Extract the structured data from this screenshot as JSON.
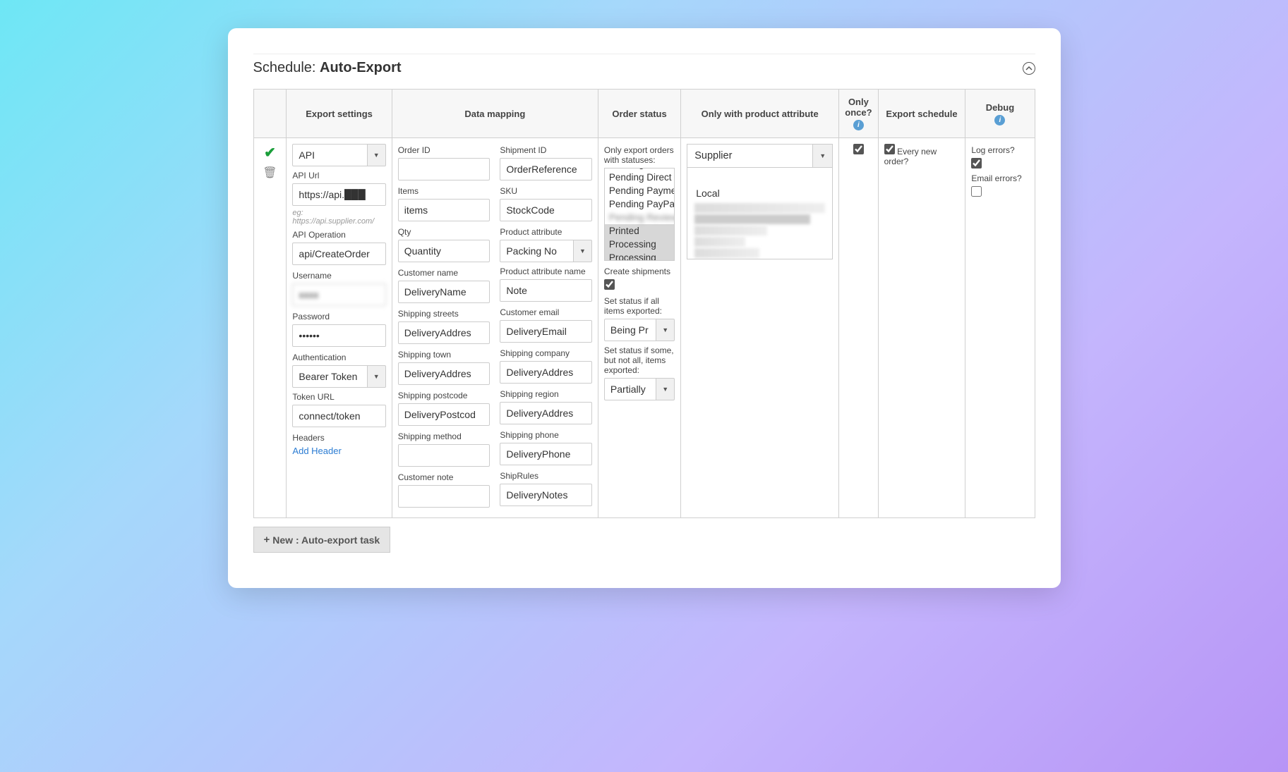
{
  "header": {
    "prefix": "Schedule: ",
    "title": "Auto-Export"
  },
  "columns": {
    "icons": "",
    "export_settings": "Export settings",
    "data_mapping": "Data mapping",
    "order_status": "Order status",
    "product_attr": "Only with product attribute",
    "only_once": "Only once?",
    "export_schedule": "Export schedule",
    "debug": "Debug"
  },
  "export_settings": {
    "method": "API",
    "api_url_label": "API Url",
    "api_url": "https://api.",
    "api_url_blur": "xxxxx",
    "api_url_hint": "eg: https://api.supplier.com/",
    "api_op_label": "API Operation",
    "api_op": "api/CreateOrder",
    "username_label": "Username",
    "username_blur": "xxxx",
    "password_label": "Password",
    "password": "••••••",
    "auth_label": "Authentication",
    "auth": "Bearer Token",
    "token_url_label": "Token URL",
    "token_url": "connect/token",
    "headers_label": "Headers",
    "add_header": "Add Header"
  },
  "mapping": {
    "left": [
      {
        "label": "Order ID",
        "value": ""
      },
      {
        "label": "Items",
        "value": "items"
      },
      {
        "label": "Qty",
        "value": "Quantity"
      },
      {
        "label": "Customer name",
        "value": "DeliveryName"
      },
      {
        "label": "Shipping streets",
        "value": "DeliveryAddres"
      },
      {
        "label": "Shipping town",
        "value": "DeliveryAddres"
      },
      {
        "label": "Shipping postcode",
        "value": "DeliveryPostcod"
      },
      {
        "label": "Shipping method",
        "value": ""
      },
      {
        "label": "Customer note",
        "value": ""
      }
    ],
    "right": [
      {
        "label": "Shipment ID",
        "value": "OrderReference"
      },
      {
        "label": "SKU",
        "value": "StockCode"
      },
      {
        "label": "Product attribute",
        "value": "Packing No",
        "select": true
      },
      {
        "label": "Product attribute name",
        "value": "Note"
      },
      {
        "label": "Customer email",
        "value": "DeliveryEmail"
      },
      {
        "label": "Shipping company",
        "value": "DeliveryAddres"
      },
      {
        "label": "Shipping region",
        "value": "DeliveryAddres"
      },
      {
        "label": "Shipping phone",
        "value": "DeliveryPhone"
      },
      {
        "label": "ShipRules",
        "value": "DeliveryNotes"
      }
    ]
  },
  "order_status": {
    "filter_label": "Only export orders with statuses:",
    "statuses": [
      {
        "text": "Pending Amazon",
        "sel": false
      },
      {
        "text": "Pending Direct",
        "sel": false
      },
      {
        "text": "Pending Payment",
        "sel": false
      },
      {
        "text": "Pending PayPal",
        "sel": false
      },
      {
        "text": "Pending Review",
        "sel": false,
        "blurred": true
      },
      {
        "text": "Printed",
        "sel": true
      },
      {
        "text": "Processing",
        "sel": true
      },
      {
        "text": "Processing",
        "sel": true
      }
    ],
    "create_shipments_label": "Create shipments",
    "create_shipments": true,
    "set_status_all_label": "Set status if all items exported:",
    "set_status_all": "Being Pr",
    "set_status_some_label": "Set status if some, but not all, items exported:",
    "set_status_some": "Partially"
  },
  "product_attr": {
    "selected": "Supplier",
    "options": [
      "",
      "Local"
    ]
  },
  "only_once": {
    "checked": true
  },
  "schedule": {
    "every_new_checked": true,
    "every_new_label": "Every new order?"
  },
  "debug": {
    "log_errors_label": "Log errors?",
    "log_errors": true,
    "email_errors_label": "Email errors?",
    "email_errors": false
  },
  "new_button": "New : Auto-export task"
}
